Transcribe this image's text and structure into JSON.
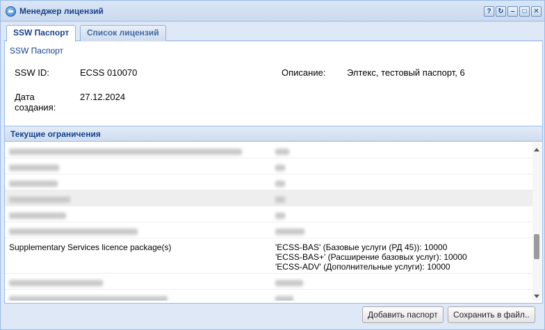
{
  "window": {
    "title": "Менеджер лицензий",
    "tools": [
      "?",
      "↻",
      "–",
      "□",
      "✕"
    ]
  },
  "tabs": [
    {
      "label": "SSW Паспорт",
      "active": true
    },
    {
      "label": "Список лицензий",
      "active": false
    }
  ],
  "passport": {
    "heading": "SSW Паспорт",
    "ssw_id_label": "SSW ID:",
    "ssw_id_value": "ECSS 010070",
    "description_label": "Описание:",
    "description_value": "Элтекс, тестовый паспорт, 6",
    "created_label": "Дата создания:",
    "created_value": "27.12.2024"
  },
  "limits": {
    "section_title": "Текущие ограничения",
    "visible_row": {
      "name": "Supplementary Services licence package(s)",
      "values": [
        "'ECSS-BAS' (Базовые услуги (РД 45)): 10000",
        "'ECSS-BAS+' (Расширение базовых услуг): 10000",
        "'ECSS-ADV' (Дополнительные услуги): 10000"
      ]
    }
  },
  "footer": {
    "add_passport": "Добавить паспорт",
    "save_to_file": "Сохранить в файл.."
  },
  "colors": {
    "accent": "#15428b",
    "border": "#99bbe8",
    "background": "#dfe8f6"
  }
}
